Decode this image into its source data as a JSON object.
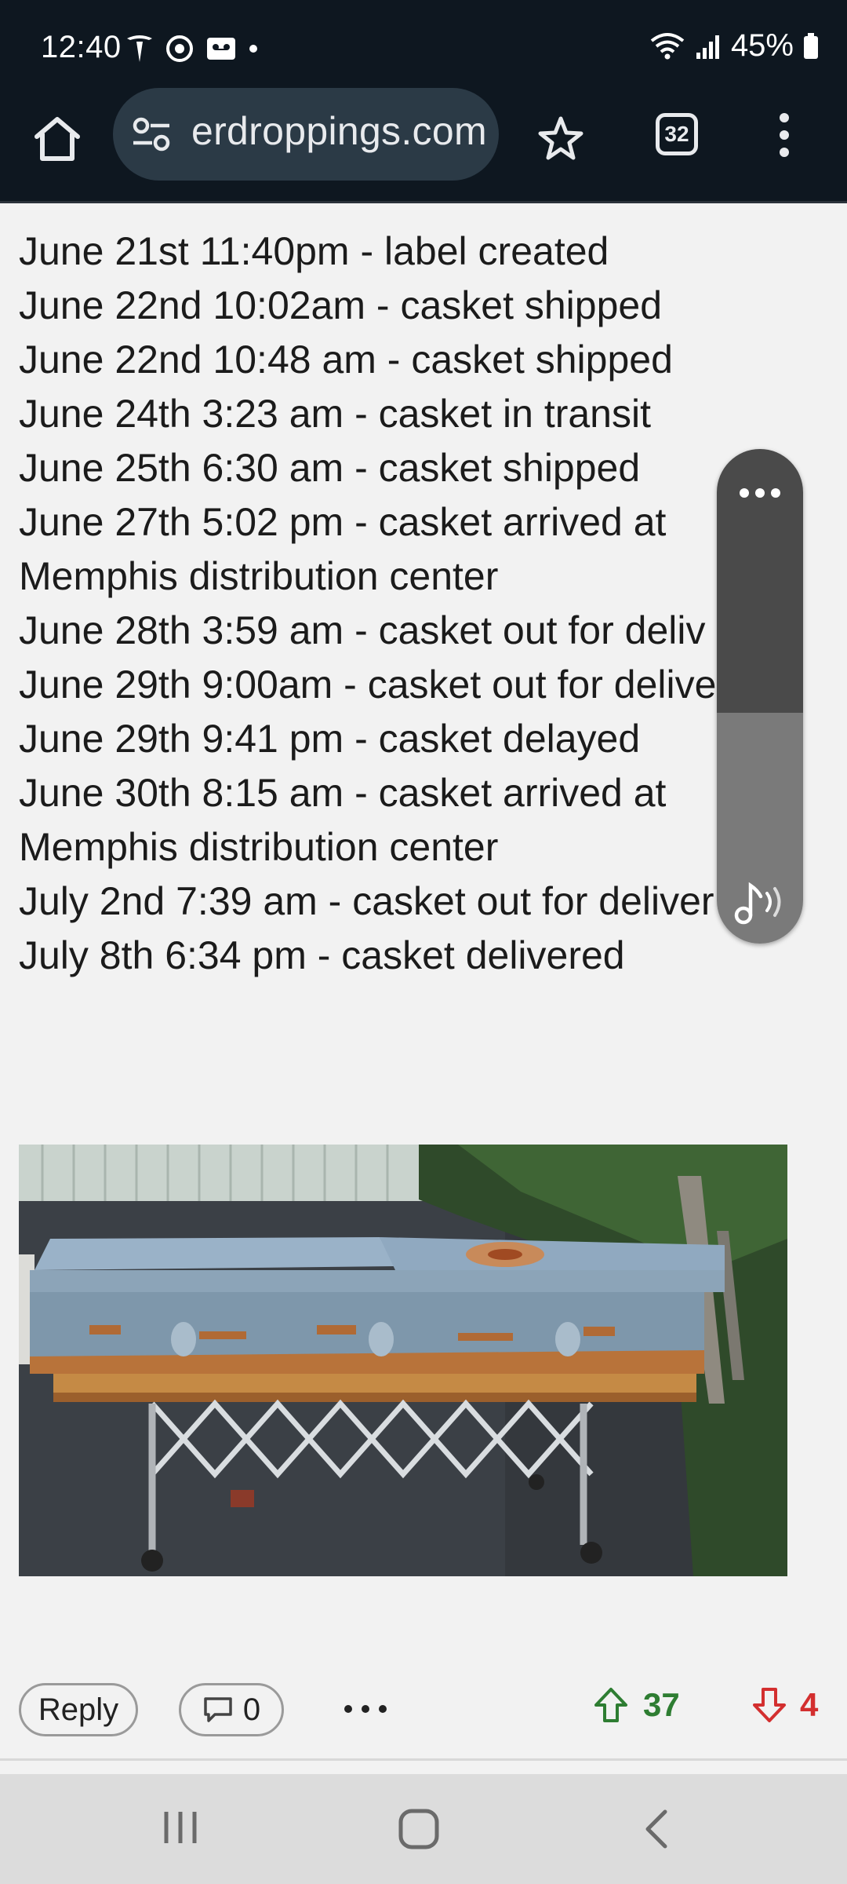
{
  "status_bar": {
    "time": "12:40",
    "battery": "45%"
  },
  "browser": {
    "url": "erdroppings.com",
    "tab_count": "32"
  },
  "tracking_log": [
    "June 21st 11:40pm - label created",
    "June 22nd 10:02am - casket shipped",
    "June 22nd 10:48 am - casket shipped",
    "June 24th 3:23 am - casket in transit",
    "June 25th 6:30 am - casket shipped",
    "June 27th 5:02 pm - casket arrived at",
    "Memphis distribution center",
    "June 28th 3:59 am - casket out for deliv",
    "June 29th 9:00am - casket out for delive",
    "June 29th 9:41 pm - casket delayed",
    "June 30th 8:15 am - casket arrived at",
    "Memphis distribution center",
    "July 2nd 7:39 am - casket out for deliver",
    "July 8th 6:34 pm - casket delivered"
  ],
  "post_actions": {
    "reply_label": "Reply",
    "comment_count": "0",
    "upvotes": "37",
    "downvotes": "4"
  },
  "icons": {
    "home": "home-icon",
    "site_settings": "tune-icon",
    "bookmark": "star-outline-icon",
    "menu": "more-vert-icon",
    "upvote": "arrow-up-outline-icon",
    "downvote": "arrow-down-outline-icon"
  },
  "colors": {
    "upvote": "#2e7d32",
    "downvote": "#d32f2f",
    "toolbar": "#0e1720"
  }
}
